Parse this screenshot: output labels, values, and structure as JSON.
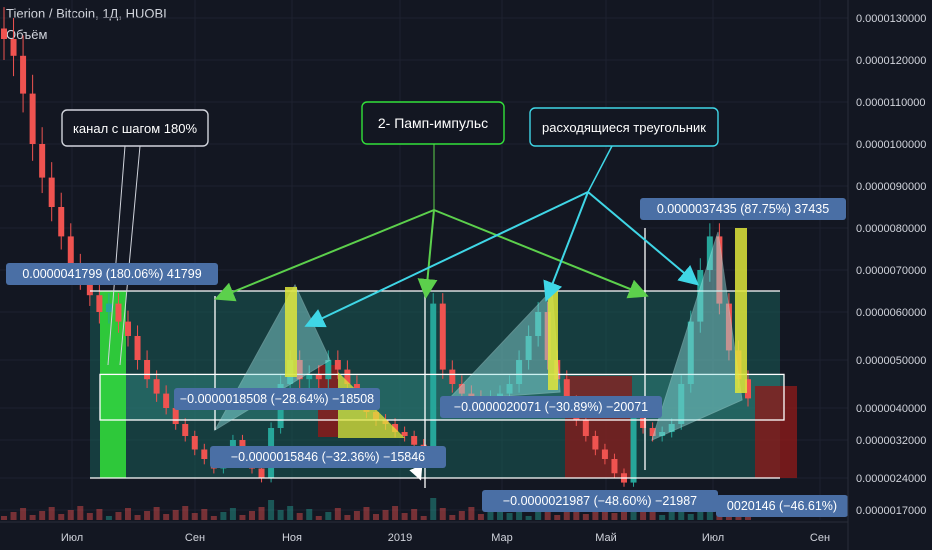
{
  "header": {
    "title": "Tierion / Bitcoin, 1Д, HUOBI",
    "subtitle": "Объём"
  },
  "colors": {
    "background": "#131722",
    "grid": "#1e2230",
    "axis_text": "#d1d4dc",
    "up_candle": "#26a69a",
    "down_candle": "#ef5350",
    "channel_fill": "#1a5c58",
    "channel_line": "#ffffff",
    "green_arrow": "#5cd04c",
    "cyan_arrow": "#3fd6e6",
    "label_bg": "#4a6fa5",
    "yellow": "#dfe63a",
    "bright_green": "#32e03a",
    "dark_red": "#8b1a1a",
    "triangle_fill": "#8fe0e0"
  },
  "chart_data": {
    "type": "candlestick",
    "title": "Tierion / Bitcoin, 1Д, HUOBI",
    "y_ticks": [
      "0.0000130000",
      "0.0000120000",
      "0.0000110000",
      "0.0000100000",
      "0.0000090000",
      "0.0000080000",
      "0.0000070000",
      "0.0000060000",
      "0.0000050000",
      "0.0000040000",
      "0.0000032000",
      "0.0000024000",
      "0.0000017000"
    ],
    "x_ticks": [
      "Июл",
      "Сен",
      "Ноя",
      "2019",
      "Мар",
      "Май",
      "Июл",
      "Сен"
    ],
    "ylim": [
      1.4e-06,
      1.34e-05
    ],
    "series_close": [
      1.25e-05,
      1.21e-05,
      1.12e-05,
      1e-05,
      9.2e-06,
      8.5e-06,
      7.8e-06,
      7.1e-06,
      6.8e-06,
      6.4e-06,
      6e-06,
      6.2e-06,
      5.8e-06,
      5.5e-06,
      5e-06,
      4.6e-06,
      4.3e-06,
      4e-06,
      3.6e-06,
      3.3e-06,
      3e-06,
      2.8e-06,
      2.6e-06,
      2.8e-06,
      3.2e-06,
      2.9e-06,
      2.6e-06,
      2.4e-06,
      3.5e-06,
      4.5e-06,
      5e-06,
      4.6e-06,
      4.7e-06,
      4.6e-06,
      5e-06,
      4.8e-06,
      4.5e-06,
      4.2e-06,
      3.9e-06,
      3.7e-06,
      3.6e-06,
      3.4e-06,
      3.3e-06,
      3.1e-06,
      3e-06,
      6.2e-06,
      4.8e-06,
      4.5e-06,
      4.3e-06,
      4.2e-06,
      4.1e-06,
      4.2e-06,
      4.3e-06,
      4.5e-06,
      5e-06,
      5.5e-06,
      6e-06,
      5e-06,
      4.6e-06,
      4.1e-06,
      3.7e-06,
      3.3e-06,
      3e-06,
      2.8e-06,
      2.5e-06,
      2.3e-06,
      3.9e-06,
      3.5e-06,
      3.3e-06,
      3.4e-06,
      3.6e-06,
      4.5e-06,
      5.8e-06,
      7e-06,
      7.8e-06,
      6.2e-06,
      5.2e-06,
      4.6e-06,
      4.2e-06
    ],
    "annotations": {
      "channel": "канал с шагом 180%",
      "pump": "2- Памп-импульс",
      "triangles": "расходящиеся треугольник",
      "m1": "0.0000041799 (180.06%) 41799",
      "m2": "−0.0000018508 (−28.64%) −18508",
      "m3": "−0.0000015846 (−32.36%) −15846",
      "m4": "−0.0000020071 (−30.89%) −20071",
      "m5": "0.0000037435 (87.75%) 37435",
      "m6": "−0.0000021987 (−48.60%) −21987",
      "m7": "0020146 (−46.61%)"
    },
    "channel_levels": {
      "top": 6.5e-06,
      "mid_high": 4.7e-06,
      "mid_low": 3.7e-06,
      "bottom": 2.4e-06
    }
  }
}
